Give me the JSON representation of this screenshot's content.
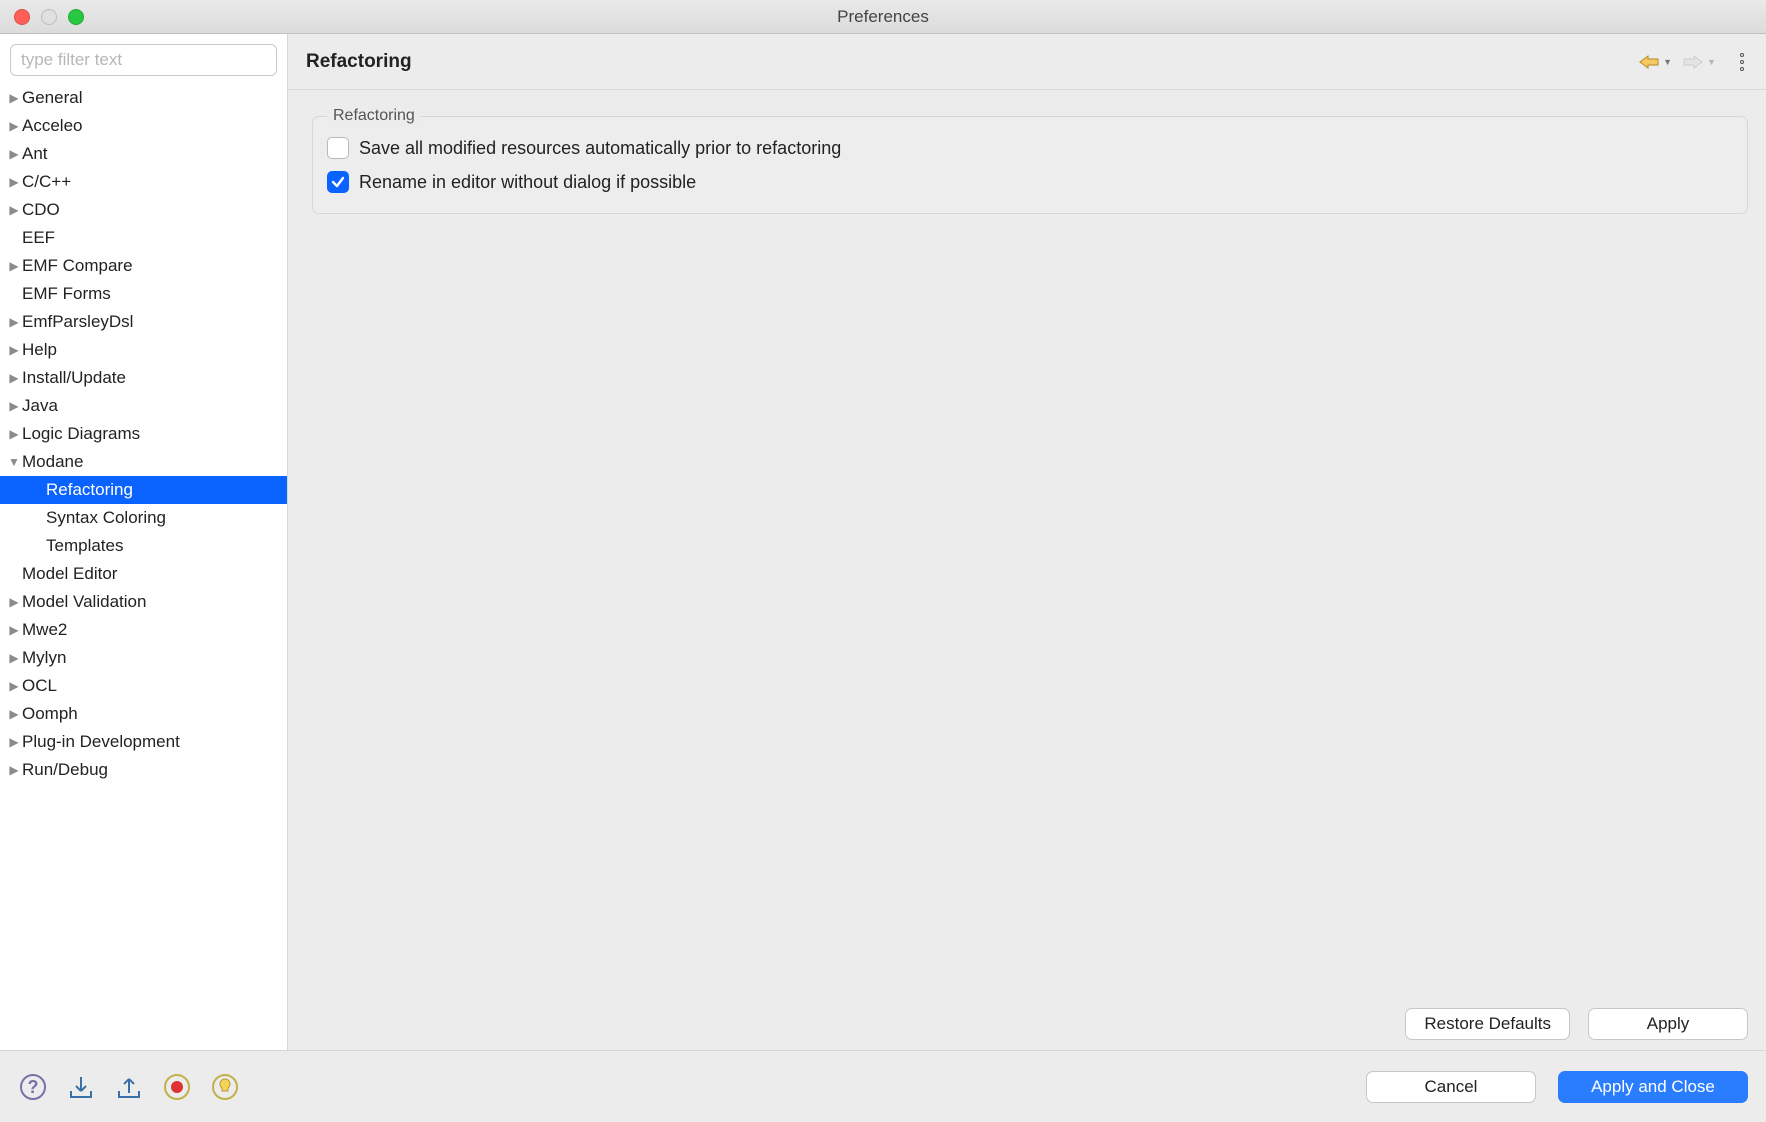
{
  "window": {
    "title": "Preferences"
  },
  "filter": {
    "placeholder": "type filter text"
  },
  "tree": [
    {
      "label": "General",
      "expandable": true,
      "expanded": false
    },
    {
      "label": "Acceleo",
      "expandable": true,
      "expanded": false
    },
    {
      "label": "Ant",
      "expandable": true,
      "expanded": false
    },
    {
      "label": "C/C++",
      "expandable": true,
      "expanded": false
    },
    {
      "label": "CDO",
      "expandable": true,
      "expanded": false
    },
    {
      "label": "EEF",
      "expandable": false,
      "expanded": false
    },
    {
      "label": "EMF Compare",
      "expandable": true,
      "expanded": false
    },
    {
      "label": "EMF Forms",
      "expandable": false,
      "expanded": false
    },
    {
      "label": "EmfParsleyDsl",
      "expandable": true,
      "expanded": false
    },
    {
      "label": "Help",
      "expandable": true,
      "expanded": false
    },
    {
      "label": "Install/Update",
      "expandable": true,
      "expanded": false
    },
    {
      "label": "Java",
      "expandable": true,
      "expanded": false
    },
    {
      "label": "Logic Diagrams",
      "expandable": true,
      "expanded": false
    },
    {
      "label": "Modane",
      "expandable": true,
      "expanded": true,
      "children": [
        {
          "label": "Refactoring",
          "selected": true
        },
        {
          "label": "Syntax Coloring"
        },
        {
          "label": "Templates"
        }
      ]
    },
    {
      "label": "Model Editor",
      "expandable": false,
      "expanded": false
    },
    {
      "label": "Model Validation",
      "expandable": true,
      "expanded": false
    },
    {
      "label": "Mwe2",
      "expandable": true,
      "expanded": false
    },
    {
      "label": "Mylyn",
      "expandable": true,
      "expanded": false
    },
    {
      "label": "OCL",
      "expandable": true,
      "expanded": false
    },
    {
      "label": "Oomph",
      "expandable": true,
      "expanded": false
    },
    {
      "label": "Plug-in Development",
      "expandable": true,
      "expanded": false
    },
    {
      "label": "Run/Debug",
      "expandable": true,
      "expanded": false
    }
  ],
  "page": {
    "title": "Refactoring",
    "group": {
      "legend": "Refactoring",
      "options": [
        {
          "label": "Save all modified resources automatically prior to refactoring",
          "checked": false
        },
        {
          "label": "Rename in editor without dialog if possible",
          "checked": true
        }
      ]
    },
    "buttons": {
      "restore_defaults": "Restore Defaults",
      "apply": "Apply"
    }
  },
  "footer": {
    "cancel": "Cancel",
    "apply_close": "Apply and Close"
  }
}
